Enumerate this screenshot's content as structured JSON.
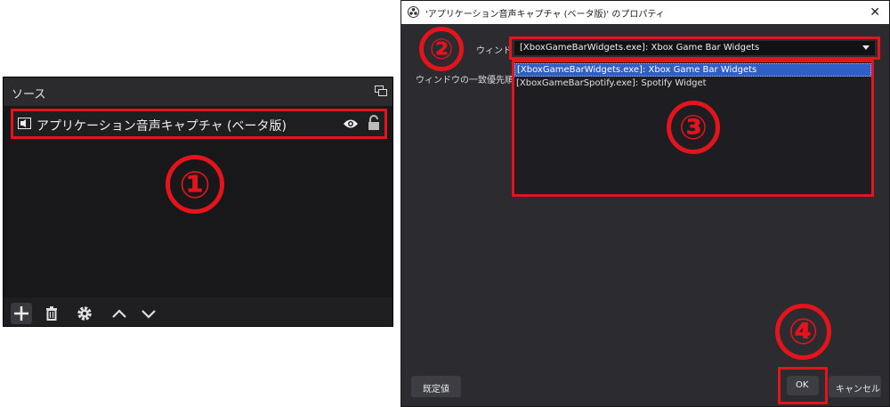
{
  "sources": {
    "title": "ソース",
    "item_label": "アプリケーション音声キャプチャ (ベータ版)",
    "icons": [
      "undock-icon",
      "audio-capture-icon",
      "eye-icon",
      "lock-icon",
      "plus-icon",
      "trash-icon",
      "gear-icon",
      "chevron-up-icon",
      "chevron-down-icon"
    ]
  },
  "dialog": {
    "title": "'アプリケーション音声キャプチャ (ベータ版)' のプロパティ",
    "close": "✕",
    "window_label": "ウィンドウ",
    "window_value": "[XboxGameBarWidgets.exe]: Xbox Game Bar Widgets",
    "priority_label": "ウィンドウの一致優先順位",
    "options": [
      "[XboxGameBarWidgets.exe]: Xbox Game Bar Widgets",
      "[XboxGameBarSpotify.exe]: Spotify Widget"
    ],
    "default_button": "既定値",
    "ok_button": "OK",
    "cancel_button": "キャンセル"
  },
  "markers": [
    "①",
    "②",
    "③",
    "④"
  ],
  "colors": {
    "highlight": "#e3141b",
    "selection": "#2f5fc4",
    "panel": "#1f1f22"
  }
}
